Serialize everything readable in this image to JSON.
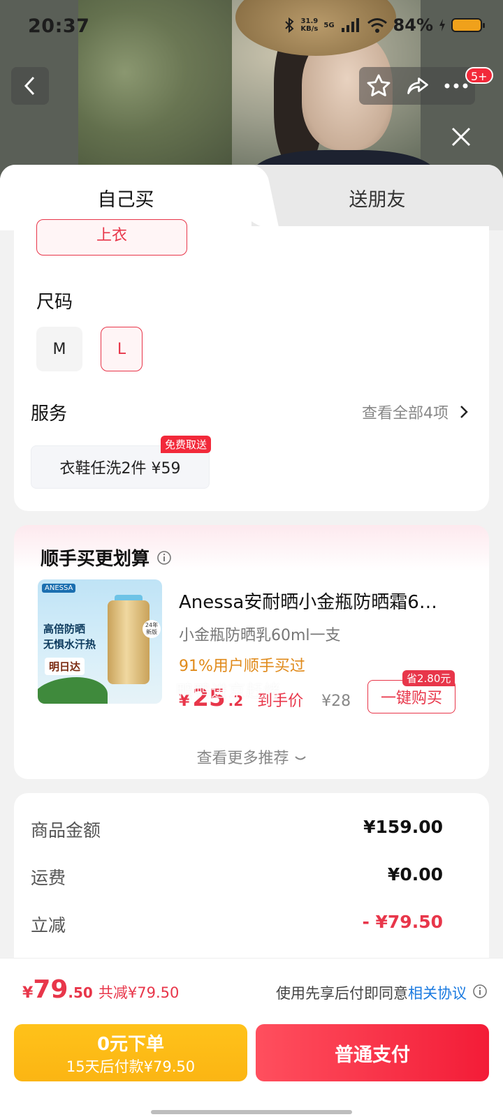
{
  "status_bar": {
    "time": "20:37",
    "net_speed_top": "31.9",
    "net_speed_unit": "KB/s",
    "net_type": "5G",
    "battery": "84%"
  },
  "header": {
    "back_icon": "chevron-left-icon",
    "favorite_icon": "star-icon",
    "share_icon": "share-icon",
    "more_icon": "more-icon",
    "badge": "5+",
    "close_icon": "close-icon"
  },
  "tabs": [
    {
      "label": "自己买",
      "active": true
    },
    {
      "label": "送朋友",
      "active": false
    }
  ],
  "options": {
    "style_chip_partial": "上衣",
    "size_title": "尺码",
    "sizes": [
      {
        "label": "M",
        "selected": false
      },
      {
        "label": "L",
        "selected": true
      }
    ],
    "service_title": "服务",
    "service_all": "查看全部4项",
    "service_item": "衣鞋任洗2件  ¥59",
    "service_tag": "免费取送"
  },
  "watermark": "鸭鸭进京赶烤",
  "recommend": {
    "title": "顺手买更划算",
    "product": {
      "name": "Anessa安耐晒小金瓶防晒霜6…",
      "spec": "小金瓶防晒乳60ml一支",
      "bought": "91%用户顺手买过",
      "price_yen": "¥",
      "price_int": "25",
      "price_dec": ".2",
      "price_label": "到手价",
      "orig_price": "¥28",
      "save_tag": "省2.80元",
      "buy_label": "一键购买",
      "image_texts": {
        "brand": "ANESSA",
        "line1": "高倍防晒",
        "line2": "无惧水汗热",
        "sticker": "明日达",
        "badge": "24年新版"
      }
    },
    "more": "查看更多推荐"
  },
  "summary": [
    {
      "key": "商品金额",
      "value": "¥159.00",
      "red": false
    },
    {
      "key": "运费",
      "value": "¥0.00",
      "red": false
    },
    {
      "key": "立减",
      "value": "- ¥79.50",
      "red": true
    }
  ],
  "bottom": {
    "total_yen": "¥",
    "total_int": "79",
    "total_dec": ".50",
    "total_reduce": "共减¥79.50",
    "agree_text": "使用先享后付即同意",
    "agree_link": "相关协议",
    "btn_zero_l1": "0元下单",
    "btn_zero_l2": "15天后付款¥79.50",
    "btn_pay": "普通支付"
  },
  "colors": {
    "accent_red": "#e8364a",
    "pay_gradient_end": "#f31c37",
    "zero_btn": "#ffc21a",
    "link_blue": "#1a7ae0",
    "bought_orange": "#e08a1a"
  }
}
